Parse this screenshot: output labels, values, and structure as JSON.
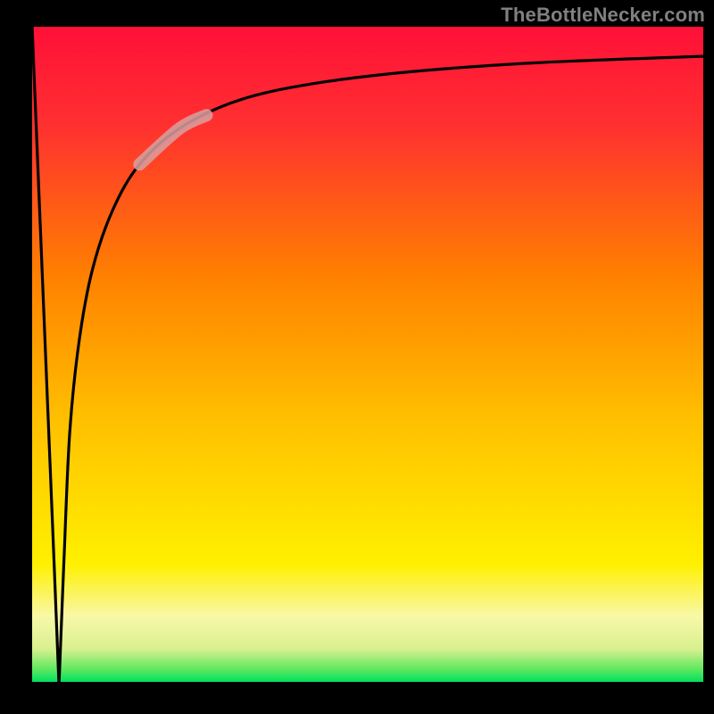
{
  "attribution": "TheBottleNecker.com",
  "chart_data": {
    "type": "line",
    "title": "",
    "xlabel": "",
    "ylabel": "",
    "xlim": [
      0,
      100
    ],
    "ylim": [
      0,
      100
    ],
    "series": [
      {
        "name": "curve",
        "x": [
          0.0,
          0.8,
          1.6,
          2.4,
          3.2,
          3.9,
          4.0,
          4.1,
          4.8,
          5.6,
          7.0,
          9.0,
          12.0,
          16.0,
          22.0,
          30.0,
          40.0,
          55.0,
          75.0,
          100.0
        ],
        "y": [
          100.0,
          80.0,
          60.0,
          40.0,
          20.0,
          2.0,
          0.0,
          2.0,
          20.0,
          38.0,
          52.0,
          63.0,
          72.0,
          79.0,
          84.5,
          88.5,
          91.0,
          93.0,
          94.5,
          95.5
        ]
      }
    ],
    "highlight_segment": {
      "x_start": 16,
      "x_end": 26
    },
    "gradient_stops": [
      {
        "offset": 0.0,
        "color": "#00e060"
      },
      {
        "offset": 0.02,
        "color": "#62e860"
      },
      {
        "offset": 0.05,
        "color": "#d8f090"
      },
      {
        "offset": 0.1,
        "color": "#f8f8a8"
      },
      {
        "offset": 0.18,
        "color": "#fff000"
      },
      {
        "offset": 0.4,
        "color": "#ffc000"
      },
      {
        "offset": 0.62,
        "color": "#ff8000"
      },
      {
        "offset": 0.85,
        "color": "#ff3030"
      },
      {
        "offset": 1.0,
        "color": "#ff1038"
      }
    ]
  }
}
